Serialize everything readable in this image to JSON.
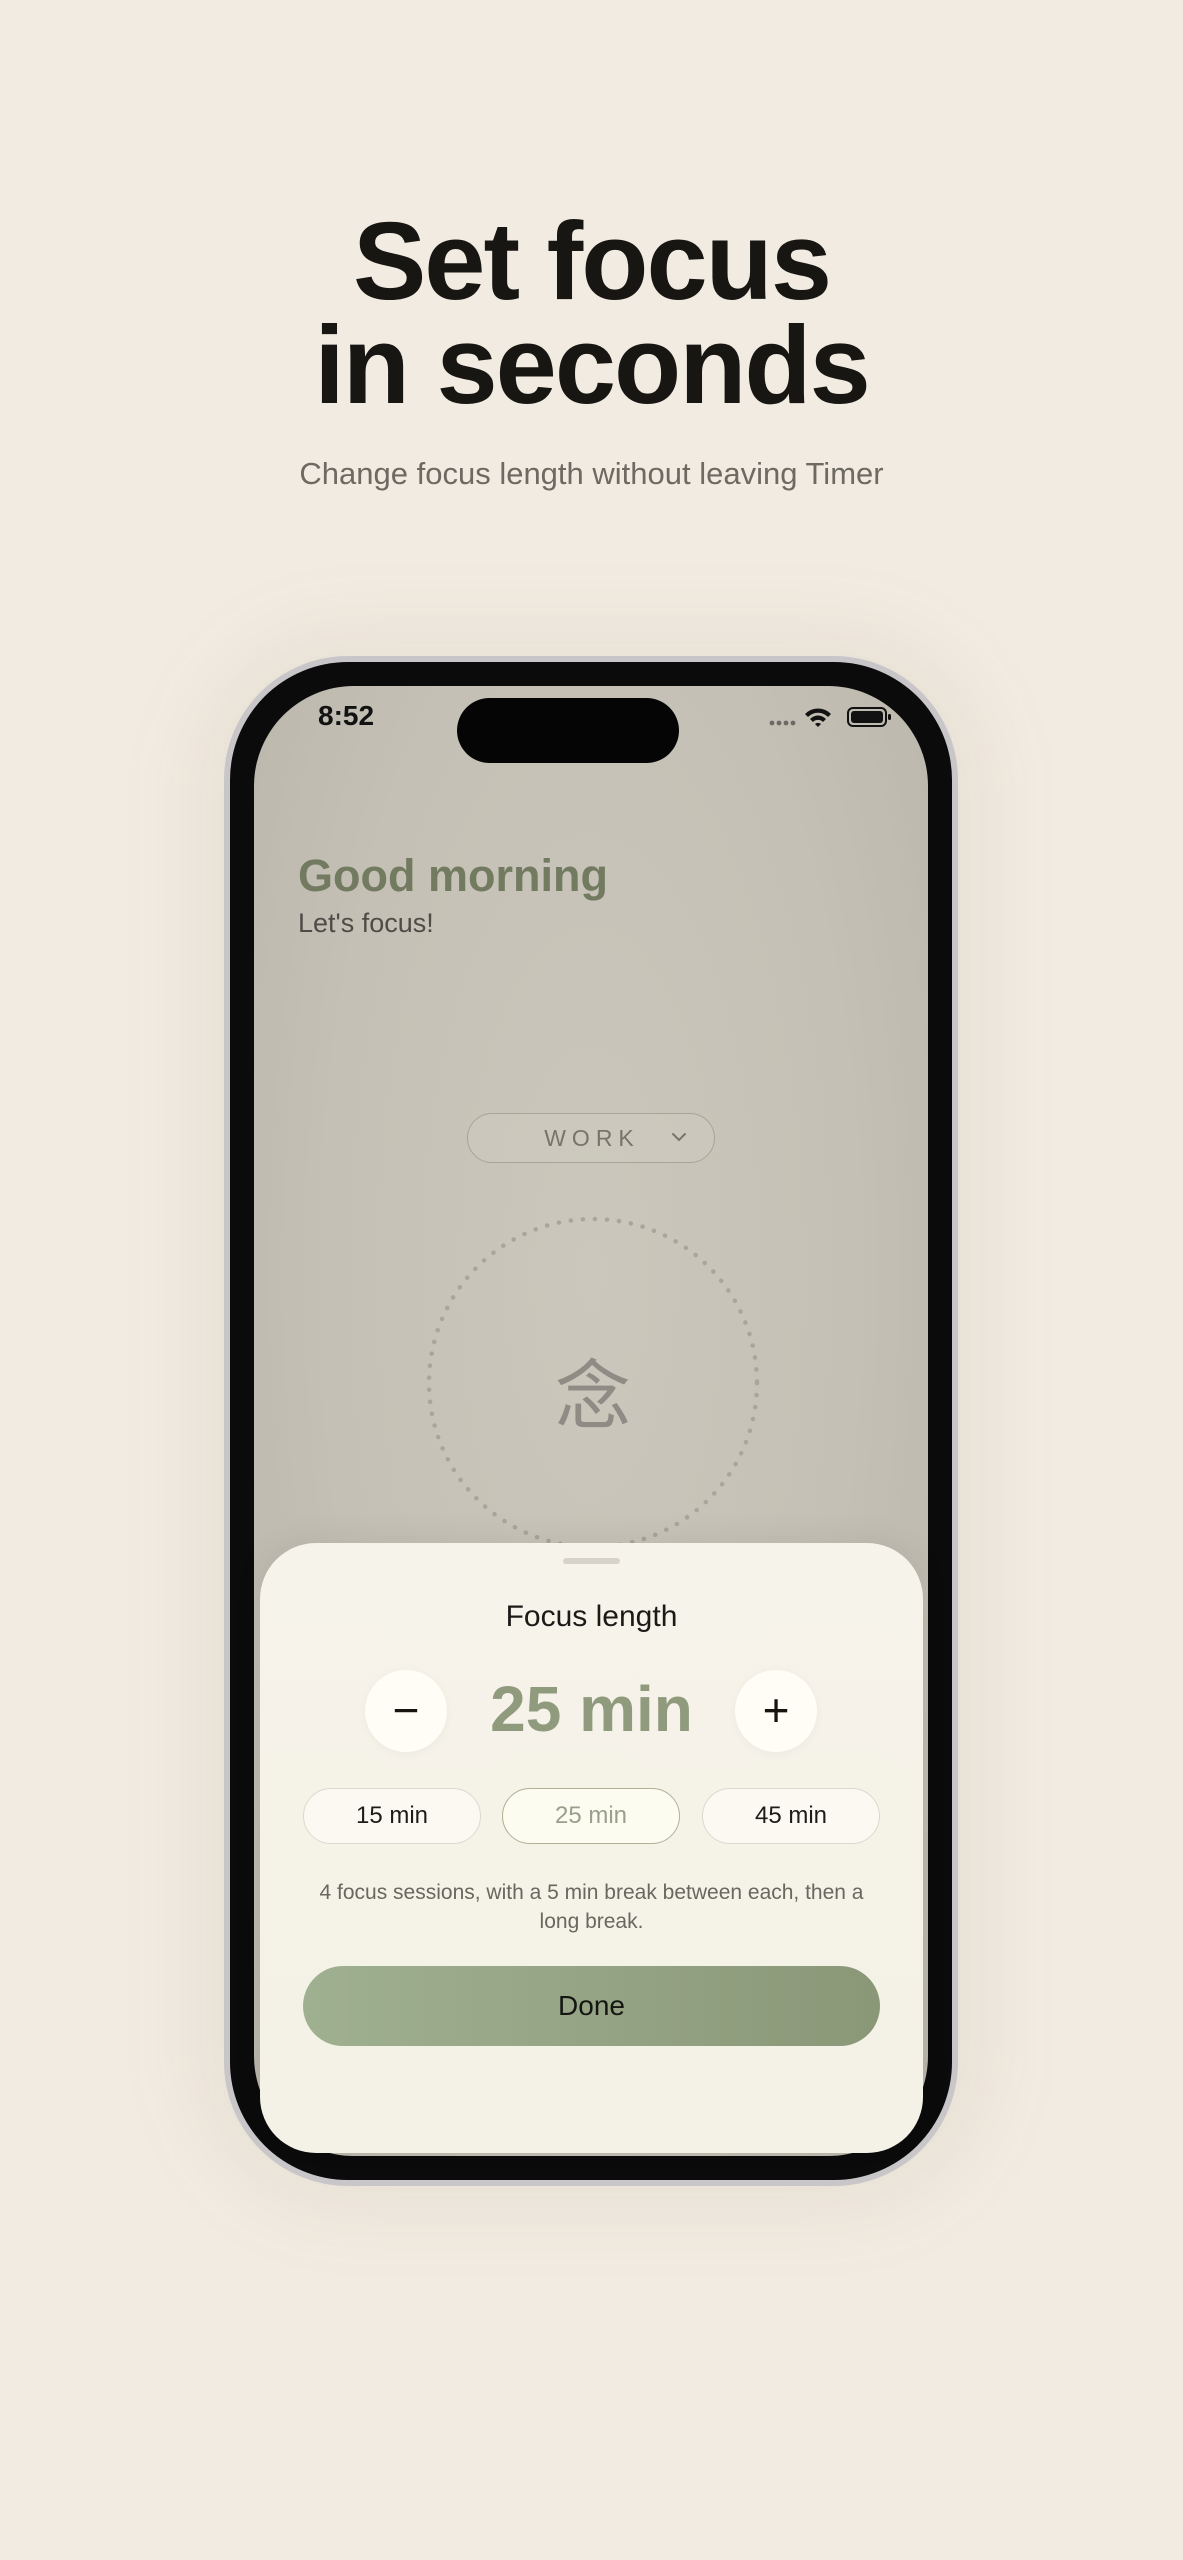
{
  "hero": {
    "title_line1": "Set focus",
    "title_line2": "in seconds",
    "subtitle": "Change focus length without leaving Timer"
  },
  "status_bar": {
    "time": "8:52",
    "icons": [
      "signal-dots-icon",
      "wifi-icon",
      "battery-icon"
    ]
  },
  "home": {
    "greeting": "Good morning",
    "subgreeting": "Let's focus!",
    "mode_label": "WORK",
    "dial_glyph": "念"
  },
  "sheet": {
    "title": "Focus length",
    "decrement_symbol": "−",
    "increment_symbol": "+",
    "value": "25 min",
    "presets": [
      {
        "label": "15 min",
        "selected": false
      },
      {
        "label": "25 min",
        "selected": true
      },
      {
        "label": "45 min",
        "selected": false
      }
    ],
    "note": "4 focus sessions, with a 5 min break between each, then a long break.",
    "done_label": "Done"
  },
  "colors": {
    "background": "#f2ebe1",
    "accent_green": "#8f9b7c",
    "button_green": "#9fb090",
    "greeting_green": "#727a60"
  }
}
